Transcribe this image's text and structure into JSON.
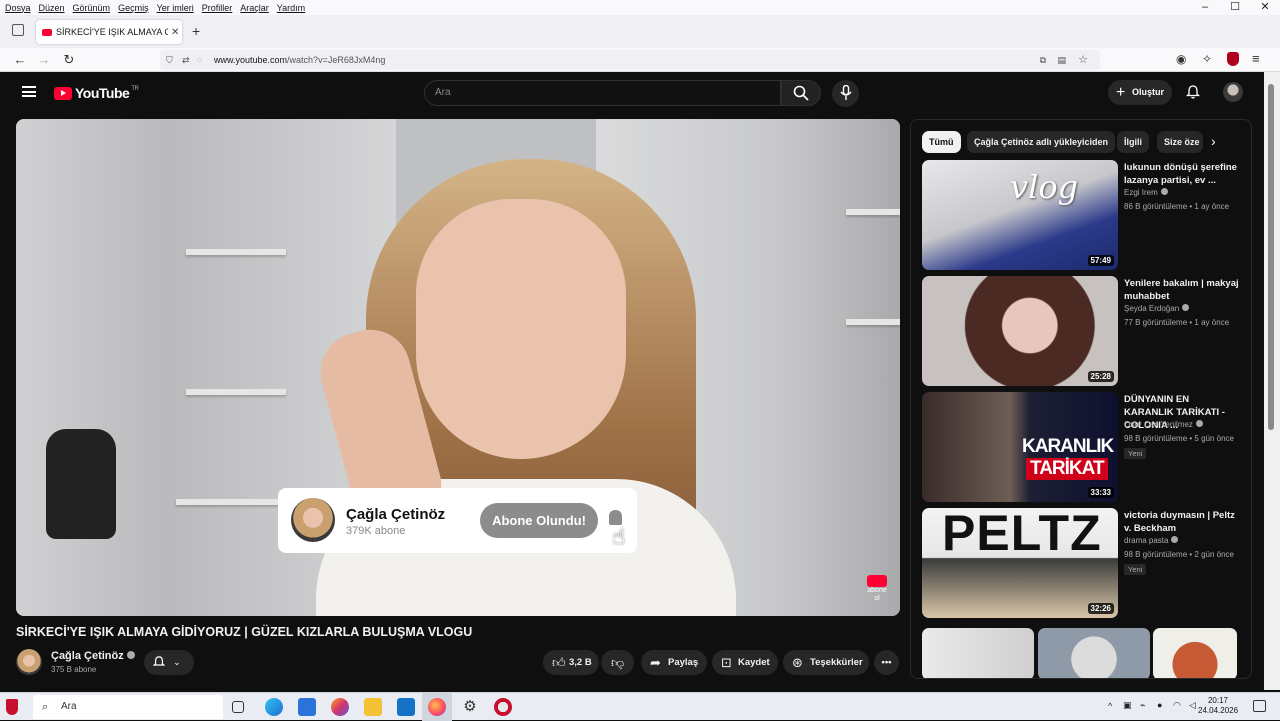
{
  "menubar": {
    "items": [
      "Dosya",
      "Düzen",
      "Görünüm",
      "Geçmiş",
      "Yer imleri",
      "Profiller",
      "Araçlar",
      "Yardım"
    ]
  },
  "window_controls": {
    "minimize": "–",
    "maximize": "☐",
    "close": "✕"
  },
  "tab": {
    "title": "SİRKECİ'YE IŞIK ALMAYA GİDİYO",
    "close": "✕",
    "new_tab": "+"
  },
  "address": {
    "host": "www.youtube.com",
    "path": "/watch?v=JeR68JxM4ng"
  },
  "youtube": {
    "logo_text": "YouTube",
    "logo_region": "TR",
    "search_placeholder": "Ara",
    "create_label": "Oluştur"
  },
  "video": {
    "title": "SİRKECİ'YE IŞIK ALMAYA GİDİYORUZ | GÜZEL KIZLARLA BULUŞMA VLOGU",
    "overlay": {
      "channel": "Çağla Çetinöz",
      "subs": "379K abone",
      "button": "Abone Olundu!"
    },
    "watermark": "abone ol"
  },
  "channel": {
    "name": "Çağla Çetinöz",
    "subs": "375 B abone"
  },
  "actions": {
    "likes": "3,2 B",
    "share": "Paylaş",
    "save": "Kaydet",
    "thanks": "Teşekkürler"
  },
  "chips": [
    "Tümü",
    "Çağla Çetinöz adlı yükleyiciden",
    "İlgili",
    "Size öze"
  ],
  "recommendations": [
    {
      "title": "lukunun dönüşü şerefine lazanya partisi, ev ...",
      "channel": "Ezgi Irem",
      "meta": "86 B görüntüleme • 1 ay önce",
      "duration": "57:49",
      "badge": ""
    },
    {
      "title": "Yenilere bakalım | makyaj muhabbet",
      "channel": "Şeyda Erdoğan",
      "meta": "77 B görüntüleme • 1 ay önce",
      "duration": "25:28",
      "badge": ""
    },
    {
      "title": "DÜNYANIN EN KARANLIK TARİKATI - COLONIA ...",
      "channel": "Onur Can Yenilmez",
      "meta": "98 B görüntüleme • 5 gün önce",
      "duration": "33:33",
      "badge": "Yeni"
    },
    {
      "title": "victoria duymasın | Peltz v. Beckham",
      "channel": "drama pasta",
      "meta": "98 B görüntüleme • 2 gün önce",
      "duration": "32:26",
      "badge": "Yeni"
    }
  ],
  "thumb_texts": {
    "vlog": "vlog",
    "karanlik_1": "KARANLIK",
    "karanlik_2": "TARİKAT",
    "peltz": "PELTZ"
  },
  "taskbar": {
    "search_placeholder": "Ara",
    "time": "20:17",
    "date": "24.04.2026"
  },
  "colors": {
    "youtube_red": "#ff0033",
    "bg": "#0f0f0f",
    "chip": "#272727"
  }
}
